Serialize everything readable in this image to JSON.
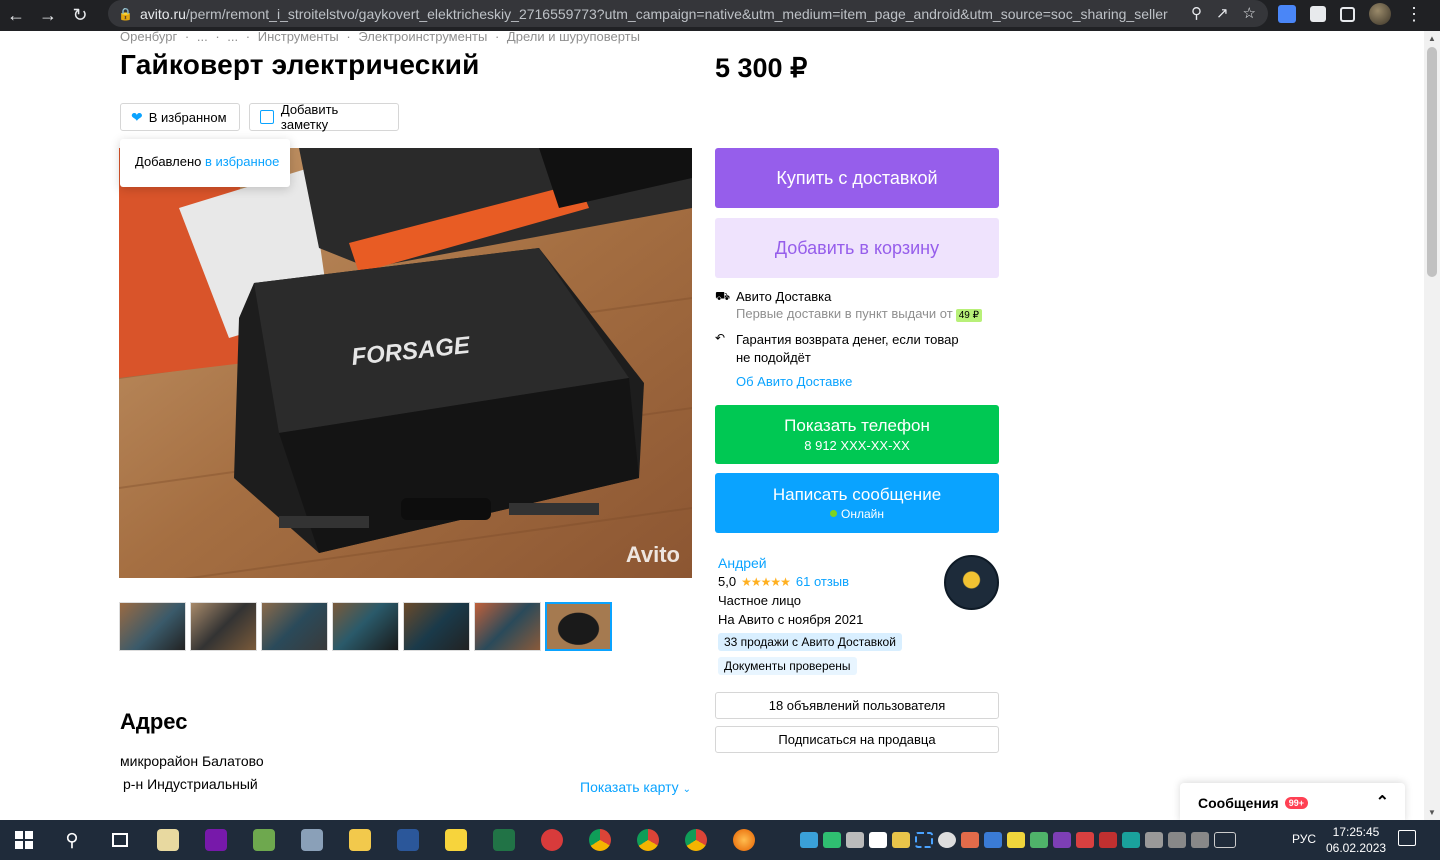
{
  "browser": {
    "url_host": "avito.ru",
    "url_rest": "/perm/remont_i_stroitelstvo/gaykovert_elektricheskiy_2716559773?utm_campaign=native&utm_medium=item_page_android&utm_source=soc_sharing_seller"
  },
  "breadcrumbs": [
    "Оренбург",
    "·",
    "...",
    "·",
    "...",
    "·",
    "Инструменты",
    "·",
    "Электроинструменты",
    "·",
    "Дрели и шуруповерты"
  ],
  "listing": {
    "title": "Гайковерт электрический",
    "price": "5 300 ₽",
    "favorite_label": "В избранном",
    "note_label": "Добавить заметку",
    "tooltip_prefix": "Добавлено ",
    "tooltip_link": "в избранное",
    "watermark": "Avito",
    "photo_brand": "FORSAGE"
  },
  "actions": {
    "buy": "Купить с доставкой",
    "cart": "Добавить в корзину",
    "phone_title": "Показать телефон",
    "phone_number": "8 912 XXX-XX-XX",
    "message_title": "Написать сообщение",
    "message_status": "Онлайн"
  },
  "delivery": {
    "title": "Авито Доставка",
    "subtitle": "Первые доставки в пункт выдачи от",
    "price_chip": "49 ₽",
    "guarantee_line1": "Гарантия возврата денег, если товар",
    "guarantee_line2": "не подойдёт",
    "link": "Об Авито Доставке"
  },
  "seller": {
    "name": "Андрей",
    "rating": "5,0",
    "stars": "★★★★★",
    "reviews": "61 отзыв",
    "type": "Частное лицо",
    "since": "На Авито с ноября 2021",
    "badge_sales": "33 продажи с Авито Доставкой",
    "badge_docs": "Документы проверены",
    "ads_button": "18 объявлений пользователя",
    "subscribe_button": "Подписаться на продавца"
  },
  "address": {
    "heading": "Адрес",
    "line1": "микрорайон Балатово",
    "line2": "р-н Индустриальный",
    "show_map": "Показать карту"
  },
  "messages_widget": {
    "label": "Сообщения",
    "count": "99+"
  },
  "taskbar": {
    "language": "РУС",
    "time": "17:25:45",
    "date": "06.02.2023"
  },
  "colors": {
    "avito_blue": "#0aa3ff",
    "buy_purple": "#965eeb",
    "phone_green": "#00c853"
  }
}
